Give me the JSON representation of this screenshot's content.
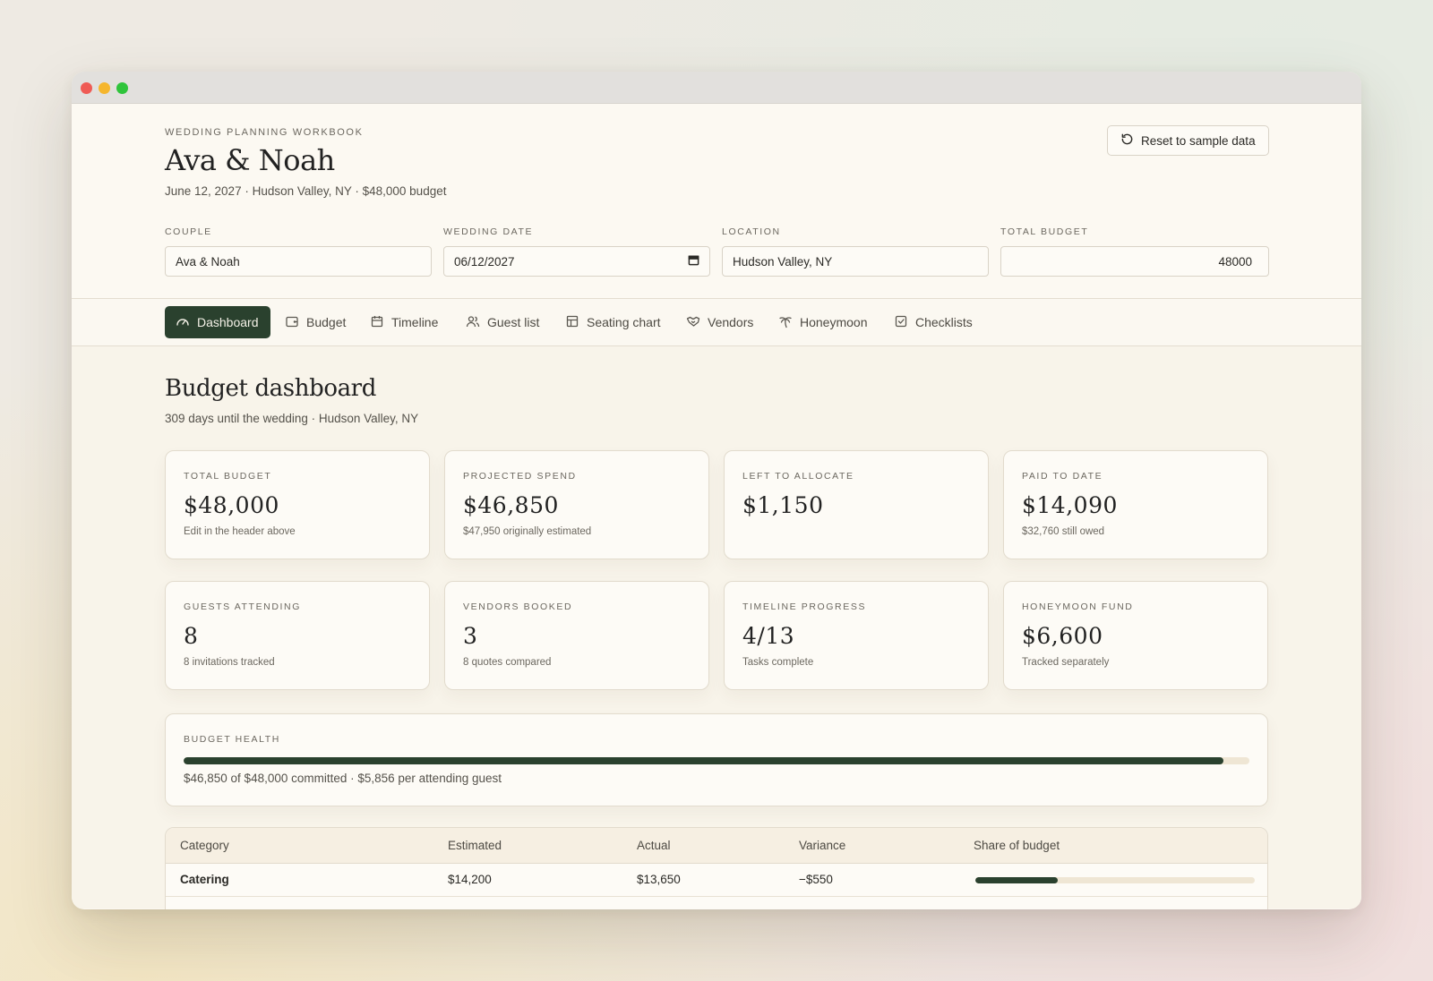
{
  "header": {
    "eyebrow": "WEDDING PLANNING WORKBOOK",
    "title": "Ava & Noah",
    "subtitle": "June 12, 2027 · Hudson Valley, NY · $48,000 budget",
    "reset_label": "Reset to sample data"
  },
  "fields": {
    "couple": {
      "label": "COUPLE",
      "value": "Ava & Noah"
    },
    "wedding_date": {
      "label": "WEDDING DATE",
      "value": "06/12/2027"
    },
    "location": {
      "label": "LOCATION",
      "value": "Hudson Valley, NY"
    },
    "total_budget": {
      "label": "TOTAL BUDGET",
      "value": "48000"
    }
  },
  "tabs": [
    {
      "label": "Dashboard",
      "icon": "gauge-icon",
      "active": true
    },
    {
      "label": "Budget",
      "icon": "wallet-icon",
      "active": false
    },
    {
      "label": "Timeline",
      "icon": "calendar-icon",
      "active": false
    },
    {
      "label": "Guest list",
      "icon": "users-icon",
      "active": false
    },
    {
      "label": "Seating chart",
      "icon": "table-icon",
      "active": false
    },
    {
      "label": "Vendors",
      "icon": "handshake-icon",
      "active": false
    },
    {
      "label": "Honeymoon",
      "icon": "palm-tree-icon",
      "active": false
    },
    {
      "label": "Checklists",
      "icon": "checkbox-icon",
      "active": false
    }
  ],
  "dashboard": {
    "title": "Budget dashboard",
    "subtitle": "309 days until the wedding · Hudson Valley, NY",
    "cards": [
      {
        "label": "TOTAL BUDGET",
        "value": "$48,000",
        "note": "Edit in the header above"
      },
      {
        "label": "PROJECTED SPEND",
        "value": "$46,850",
        "note": "$47,950 originally estimated"
      },
      {
        "label": "LEFT TO ALLOCATE",
        "value": "$1,150",
        "note": ""
      },
      {
        "label": "PAID TO DATE",
        "value": "$14,090",
        "note": "$32,760 still owed"
      },
      {
        "label": "GUESTS ATTENDING",
        "value": "8",
        "note": "8 invitations tracked"
      },
      {
        "label": "VENDORS BOOKED",
        "value": "3",
        "note": "8 quotes compared"
      },
      {
        "label": "TIMELINE PROGRESS",
        "value": "4/13",
        "note": "Tasks complete"
      },
      {
        "label": "HONEYMOON FUND",
        "value": "$6,600",
        "note": "Tracked separately"
      }
    ],
    "health": {
      "label": "BUDGET HEALTH",
      "fraction": 0.976,
      "note": "$46,850 of $48,000 committed · $5,856 per attending guest"
    }
  },
  "table": {
    "headers": [
      "Category",
      "Estimated",
      "Actual",
      "Variance",
      "Share of budget"
    ],
    "rows": [
      {
        "category": "Catering",
        "estimated": "$14,200",
        "actual": "$13,650",
        "variance": "−$550",
        "share": 0.296
      }
    ]
  },
  "colors": {
    "accent": "#2a412e",
    "background": "#f8f4ea",
    "track": "#efe6d4"
  }
}
